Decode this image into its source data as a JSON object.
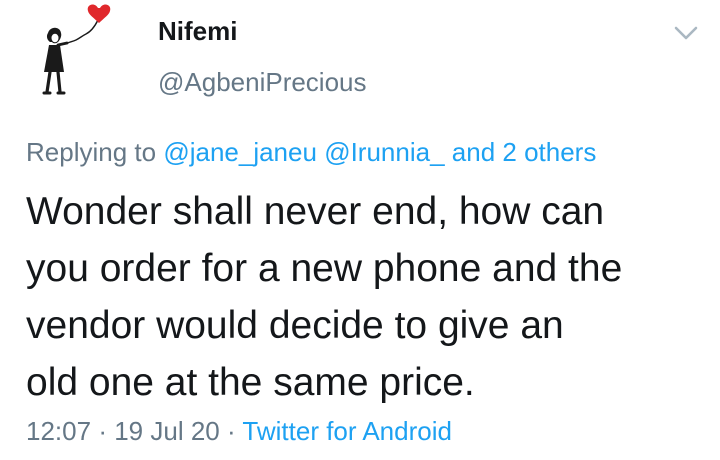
{
  "author": {
    "display_name": "Nifemi",
    "handle": "@AgbeniPrecious",
    "avatar_icon": "girl-with-red-balloon-icon"
  },
  "reply": {
    "prefix": "Replying to",
    "mention_1": "@jane_janeu",
    "mention_2": "@Irunnia_",
    "others": "and 2 others"
  },
  "tweet": {
    "text_lines": [
      "Wonder shall never end, how can",
      "you order for a new phone and the",
      "vendor would decide to give an",
      "old one at the same price."
    ]
  },
  "meta": {
    "time": "12:07",
    "separator": "·",
    "date": "19 Jul 20",
    "source": "Twitter for Android"
  },
  "menu": {
    "icon": "chevron-down-icon"
  },
  "colors": {
    "text": "#14171a",
    "secondary": "#657786",
    "link": "#1da1f2",
    "balloon": "#e0282c"
  }
}
